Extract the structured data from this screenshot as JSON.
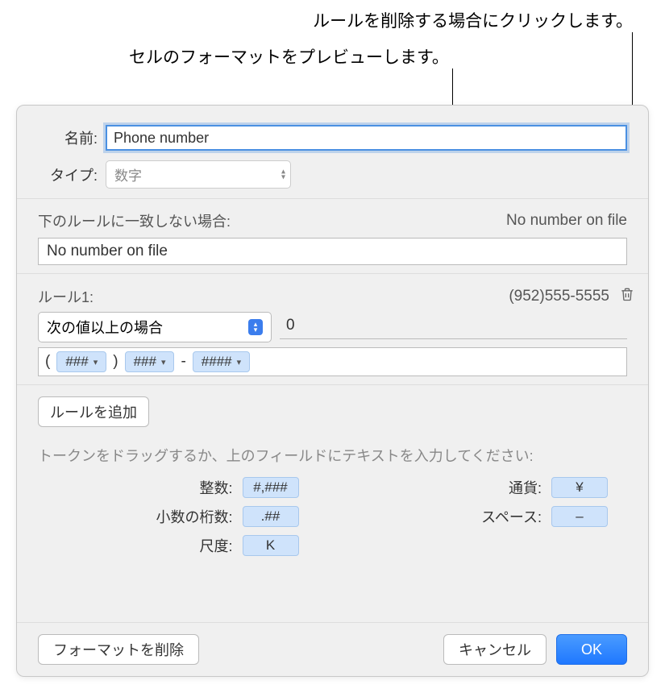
{
  "callouts": {
    "delete_rule": "ルールを削除する場合にクリックします。",
    "preview_format": "セルのフォーマットをプレビューします。"
  },
  "fields": {
    "name_label": "名前:",
    "name_value": "Phone number",
    "type_label": "タイプ:",
    "type_value": "数字"
  },
  "no_match": {
    "label": "下のルールに一致しない場合:",
    "preview": "No number on file",
    "value": "No number on file"
  },
  "rule1": {
    "label": "ルール1:",
    "preview": "(952)555-5555",
    "condition": "次の値以上の場合",
    "value": "0",
    "paren_open": "(",
    "paren_close": ")",
    "token1": "###",
    "token2": "###",
    "dash": "-",
    "token3": "####"
  },
  "add_rule": "ルールを追加",
  "tokens_help": "トークンをドラッグするか、上のフィールドにテキストを入力してください:",
  "tokens": {
    "integer_label": "整数:",
    "integer_val": "#,###",
    "decimal_label": "小数の桁数:",
    "decimal_val": ".##",
    "scale_label": "尺度:",
    "scale_val": "K",
    "currency_label": "通貨:",
    "currency_val": "¥",
    "space_label": "スペース:",
    "space_val": "–"
  },
  "footer": {
    "delete_format": "フォーマットを削除",
    "cancel": "キャンセル",
    "ok": "OK"
  }
}
